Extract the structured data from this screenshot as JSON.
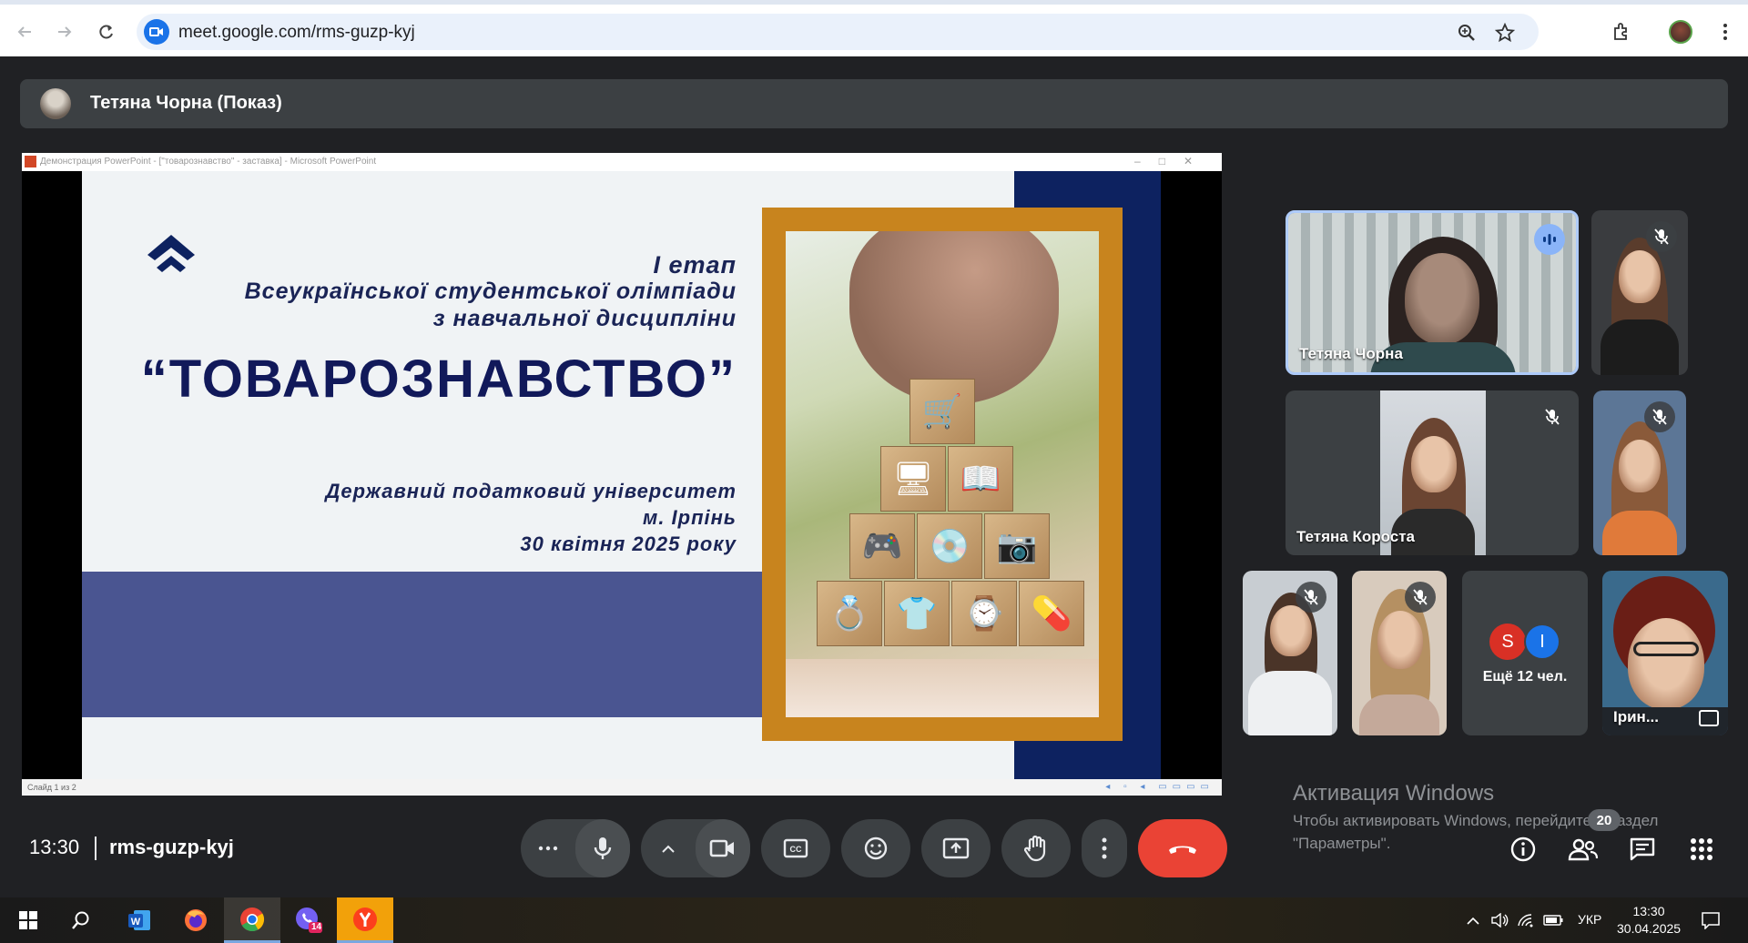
{
  "browser": {
    "url": "meet.google.com/rms-guzp-kyj"
  },
  "presenter_bar": {
    "name": "Тетяна Чорна (Показ)"
  },
  "shared_screen": {
    "window_title": "Демонстрация PowerPoint - [\"товарознавство\" - заставка] - Microsoft PowerPoint",
    "status_text": "Слайд 1 из 2",
    "slide": {
      "line1": "І етап",
      "line2": "Всеукраїнської студентської олімпіади",
      "line3": "з навчальної дисципліни",
      "title": "“ТОВАРОЗНАВСТВО”",
      "line4": "Державний податковий університет",
      "line5": "м. Ірпінь",
      "line6": "30 квітня 2025 року"
    }
  },
  "participants": {
    "featured_name": "Тетяна Чорна",
    "second_name": "Тетяна Короста",
    "more_label": "Ещё 12 чел.",
    "more_initial_1": "S",
    "more_initial_2": "I",
    "last_name": "Ірин..."
  },
  "watermark": {
    "title": "Активация Windows",
    "text": "Чтобы активировать Windows, перейдите в раздел \"Параметры\"."
  },
  "meeting": {
    "time": "13:30",
    "code": "rms-guzp-kyj",
    "people_count": "20"
  },
  "taskbar": {
    "language": "УКР",
    "time": "13:30",
    "date": "30.04.2025",
    "viber_badge": "14"
  },
  "colors": {
    "end_call": "#ea4335",
    "meet_bg": "#202124",
    "slide_navy": "#0d2260",
    "photo_frame": "#c8841e"
  }
}
